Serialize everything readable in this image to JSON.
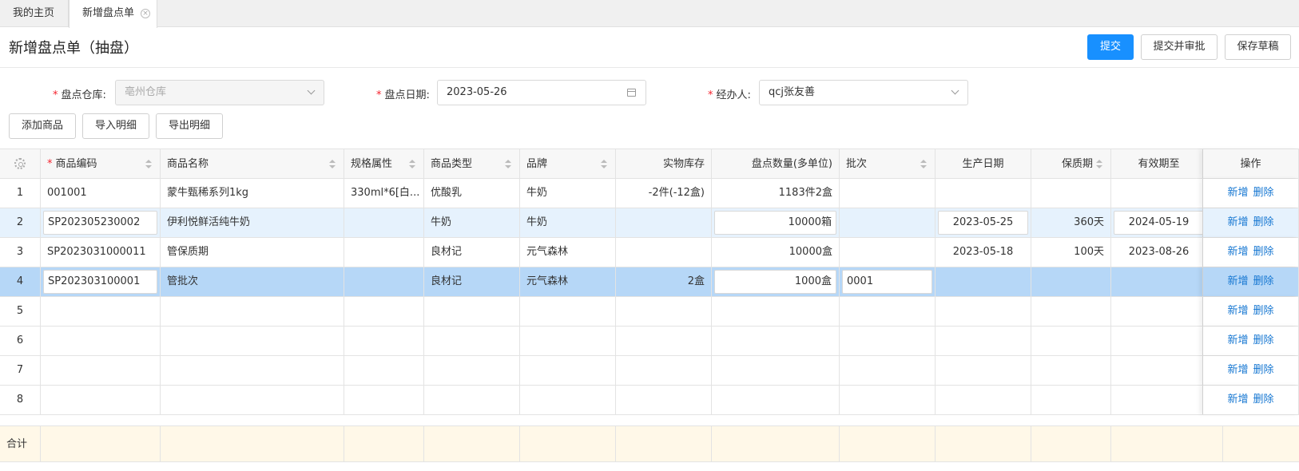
{
  "tabs": [
    {
      "label": "我的主页"
    },
    {
      "label": "新增盘点单"
    }
  ],
  "page": {
    "title": "新增盘点单（抽盘）"
  },
  "actions": {
    "submit": "提交",
    "submit_approve": "提交并审批",
    "save_draft": "保存草稿"
  },
  "form": {
    "warehouse": {
      "label": "盘点仓库:",
      "value": "亳州仓库"
    },
    "date": {
      "label": "盘点日期:",
      "value": "2023-05-26"
    },
    "handler": {
      "label": "经办人:",
      "value": "qcj张友善"
    }
  },
  "toolbar": {
    "add_goods": "添加商品",
    "import_detail": "导入明细",
    "export_detail": "导出明细"
  },
  "table": {
    "headers": {
      "code": "商品编码",
      "name": "商品名称",
      "spec": "规格属性",
      "type": "商品类型",
      "brand": "品牌",
      "stock": "实物库存",
      "count_qty": "盘点数量(多单位)",
      "batch": "批次",
      "prod_date": "生产日期",
      "shelf_life": "保质期",
      "expiry": "有效期至",
      "ops": "操作"
    },
    "rows": [
      {
        "no": "1",
        "code": "001001",
        "name": "蒙牛甄稀系列1kg",
        "spec": "330ml*6[白...",
        "type": "优酸乳",
        "brand": "牛奶",
        "stock": "-2件(-12盒)",
        "count_qty": "1183件2盒",
        "batch": "",
        "prod_date": "",
        "shelf_life": "",
        "expiry": ""
      },
      {
        "no": "2",
        "code": "SP202305230002",
        "name": "伊利悦鲜活纯牛奶",
        "spec": "",
        "type": "牛奶",
        "brand": "牛奶",
        "stock": "",
        "count_qty": "10000箱",
        "batch": "",
        "prod_date": "2023-05-25",
        "shelf_life": "360天",
        "expiry": "2024-05-19"
      },
      {
        "no": "3",
        "code": "SP2023031000011",
        "name": "管保质期",
        "spec": "",
        "type": "良材记",
        "brand": "元气森林",
        "stock": "",
        "count_qty": "10000盒",
        "batch": "",
        "prod_date": "2023-05-18",
        "shelf_life": "100天",
        "expiry": "2023-08-26"
      },
      {
        "no": "4",
        "code": "SP202303100001",
        "name": "管批次",
        "spec": "",
        "type": "良材记",
        "brand": "元气森林",
        "stock": "2盒",
        "count_qty": "1000盒",
        "batch": "0001",
        "prod_date": "",
        "shelf_life": "",
        "expiry": ""
      },
      {
        "no": "5"
      },
      {
        "no": "6"
      },
      {
        "no": "7"
      },
      {
        "no": "8"
      }
    ],
    "op_add": "新增",
    "op_delete": "删除",
    "total_label": "合计"
  }
}
